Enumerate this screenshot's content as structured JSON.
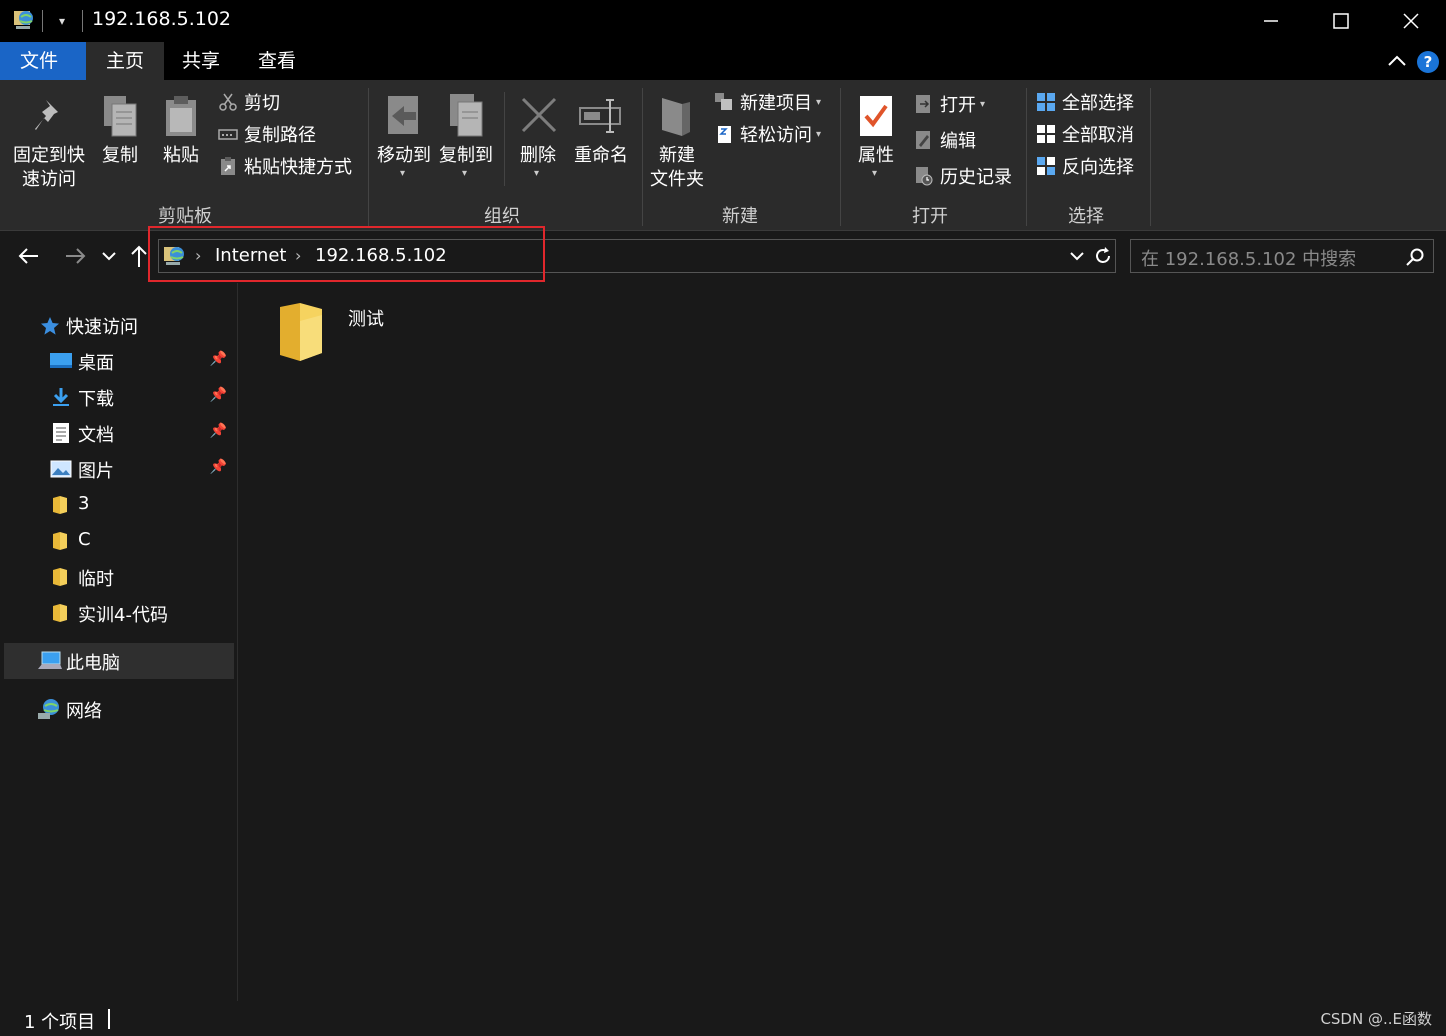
{
  "window": {
    "title": "192.168.5.102"
  },
  "tabs": {
    "file": "文件",
    "home": "主页",
    "share": "共享",
    "view": "查看"
  },
  "ribbon": {
    "clipboard": {
      "label": "剪贴板",
      "pin_line1": "固定到快",
      "pin_line2": "速访问",
      "copy": "复制",
      "paste": "粘贴",
      "cut": "剪切",
      "copy_path": "复制路径",
      "paste_shortcut": "粘贴快捷方式"
    },
    "organize": {
      "label": "组织",
      "move_to": "移动到",
      "copy_to": "复制到",
      "delete": "删除",
      "rename": "重命名"
    },
    "new": {
      "label": "新建",
      "new_folder_line1": "新建",
      "new_folder_line2": "文件夹",
      "new_item": "新建项目",
      "easy_access": "轻松访问"
    },
    "open": {
      "label": "打开",
      "properties": "属性",
      "open": "打开",
      "edit": "编辑",
      "history": "历史记录"
    },
    "select": {
      "label": "选择",
      "select_all": "全部选择",
      "select_none": "全部取消",
      "invert": "反向选择"
    }
  },
  "address": {
    "crumbs": [
      "Internet",
      "192.168.5.102"
    ],
    "search_placeholder": "在 192.168.5.102 中搜索"
  },
  "sidebar": {
    "quick_access": "快速访问",
    "items": [
      {
        "label": "桌面",
        "pinned": true
      },
      {
        "label": "下载",
        "pinned": true
      },
      {
        "label": "文档",
        "pinned": true
      },
      {
        "label": "图片",
        "pinned": true
      },
      {
        "label": "3",
        "pinned": false
      },
      {
        "label": "C",
        "pinned": false
      },
      {
        "label": "临时",
        "pinned": false
      },
      {
        "label": "实训4-代码",
        "pinned": false
      }
    ],
    "this_pc": "此电脑",
    "network": "网络"
  },
  "content": {
    "items": [
      {
        "name": "测试"
      }
    ]
  },
  "status": {
    "count": "1 个项目",
    "watermark": "CSDN @..E函数"
  },
  "colors": {
    "accent": "#1a65c6",
    "highlight_box": "#e0272c",
    "folder": "#f4c542"
  }
}
